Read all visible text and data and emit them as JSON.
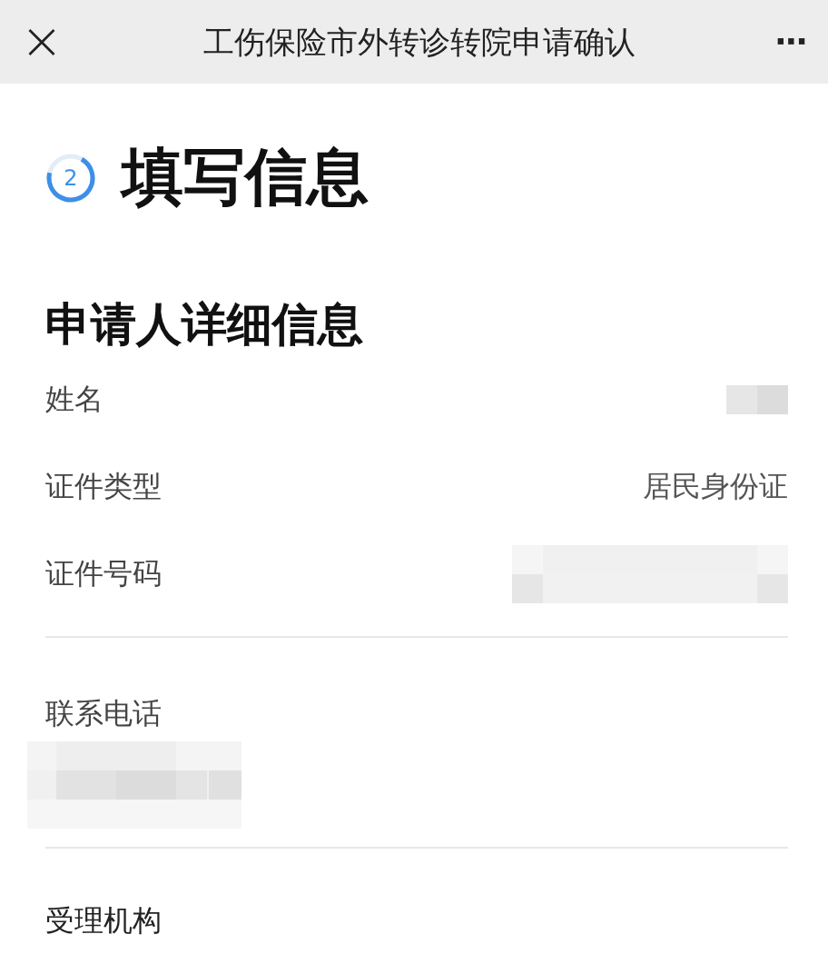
{
  "header": {
    "close_icon": "×",
    "title": "工伤保险市外转诊转院申请确认",
    "more_icon": "···"
  },
  "step": {
    "number": "2",
    "title": "填写信息"
  },
  "section": {
    "title": "申请人详细信息"
  },
  "fields": [
    {
      "kind": "inline",
      "label": "姓名",
      "redacted": true
    },
    {
      "kind": "inline",
      "label": "证件类型",
      "value": "居民身份证",
      "redacted": false
    },
    {
      "kind": "inline",
      "label": "证件号码",
      "redacted": true
    },
    {
      "kind": "divider"
    },
    {
      "kind": "stacked",
      "label": "联系电话",
      "redacted": true
    },
    {
      "kind": "divider"
    },
    {
      "kind": "stacked",
      "label": "受理机构",
      "redacted": false
    }
  ]
}
